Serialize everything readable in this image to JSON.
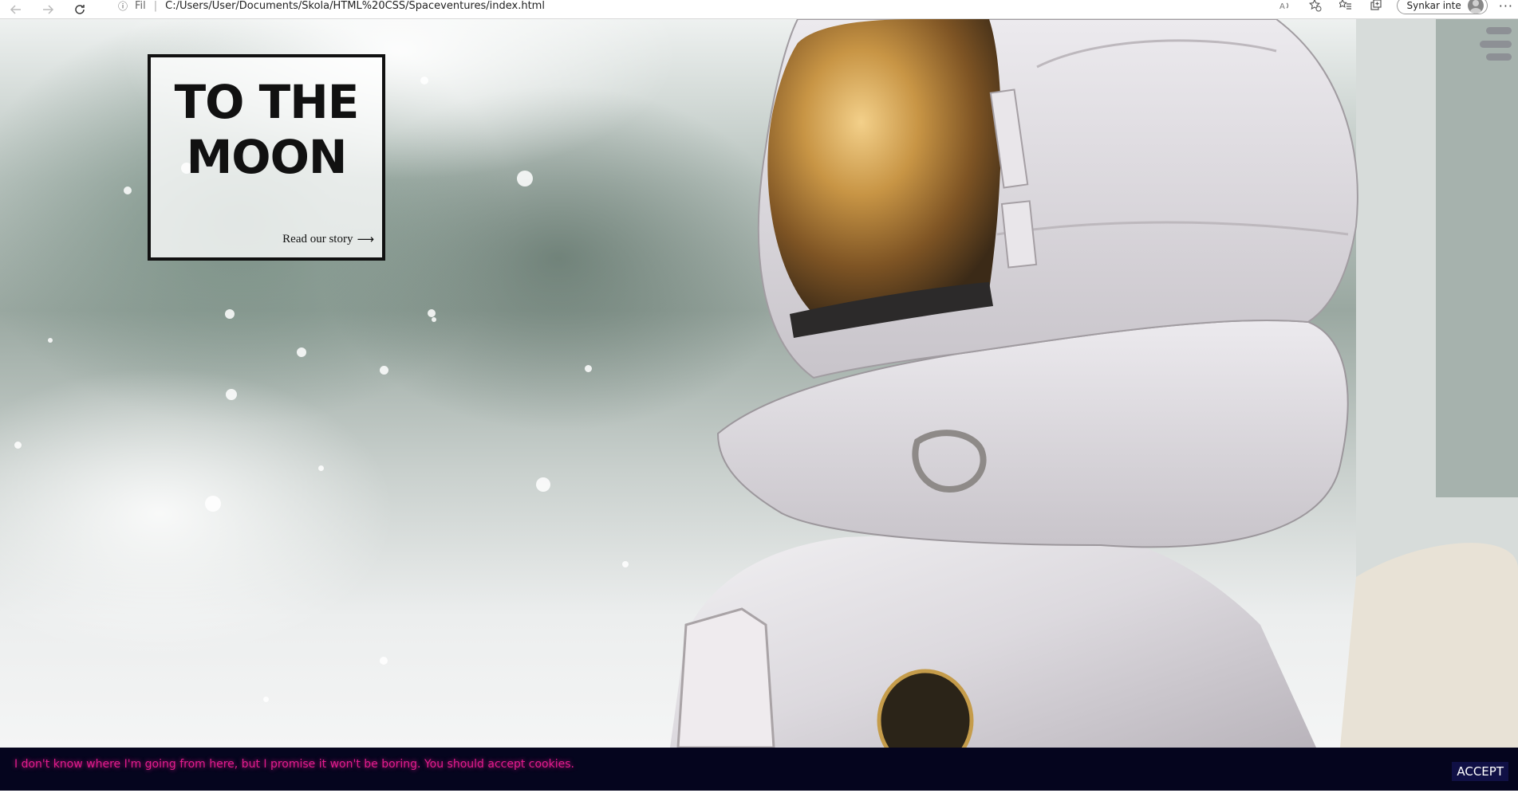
{
  "browser": {
    "url_scheme": "Fil",
    "url": "C:/Users/User/Documents/Skola/HTML%20CSS/Spaceventures/index.html",
    "sync_status": "Synkar inte"
  },
  "hero": {
    "title": "TO THE MOON",
    "story_link": "Read our story",
    "image_subject": "astronaut-helmet-photo"
  },
  "cookie": {
    "message": "I don't know where I'm going from here, but I promise it won't be boring. You should accept cookies.",
    "accept_label": "ACCEPT"
  },
  "colors": {
    "cookie_bar_bg": "#05051e",
    "cookie_text": "#e21b8d",
    "accept_bg": "#101045",
    "card_border": "#111111"
  }
}
